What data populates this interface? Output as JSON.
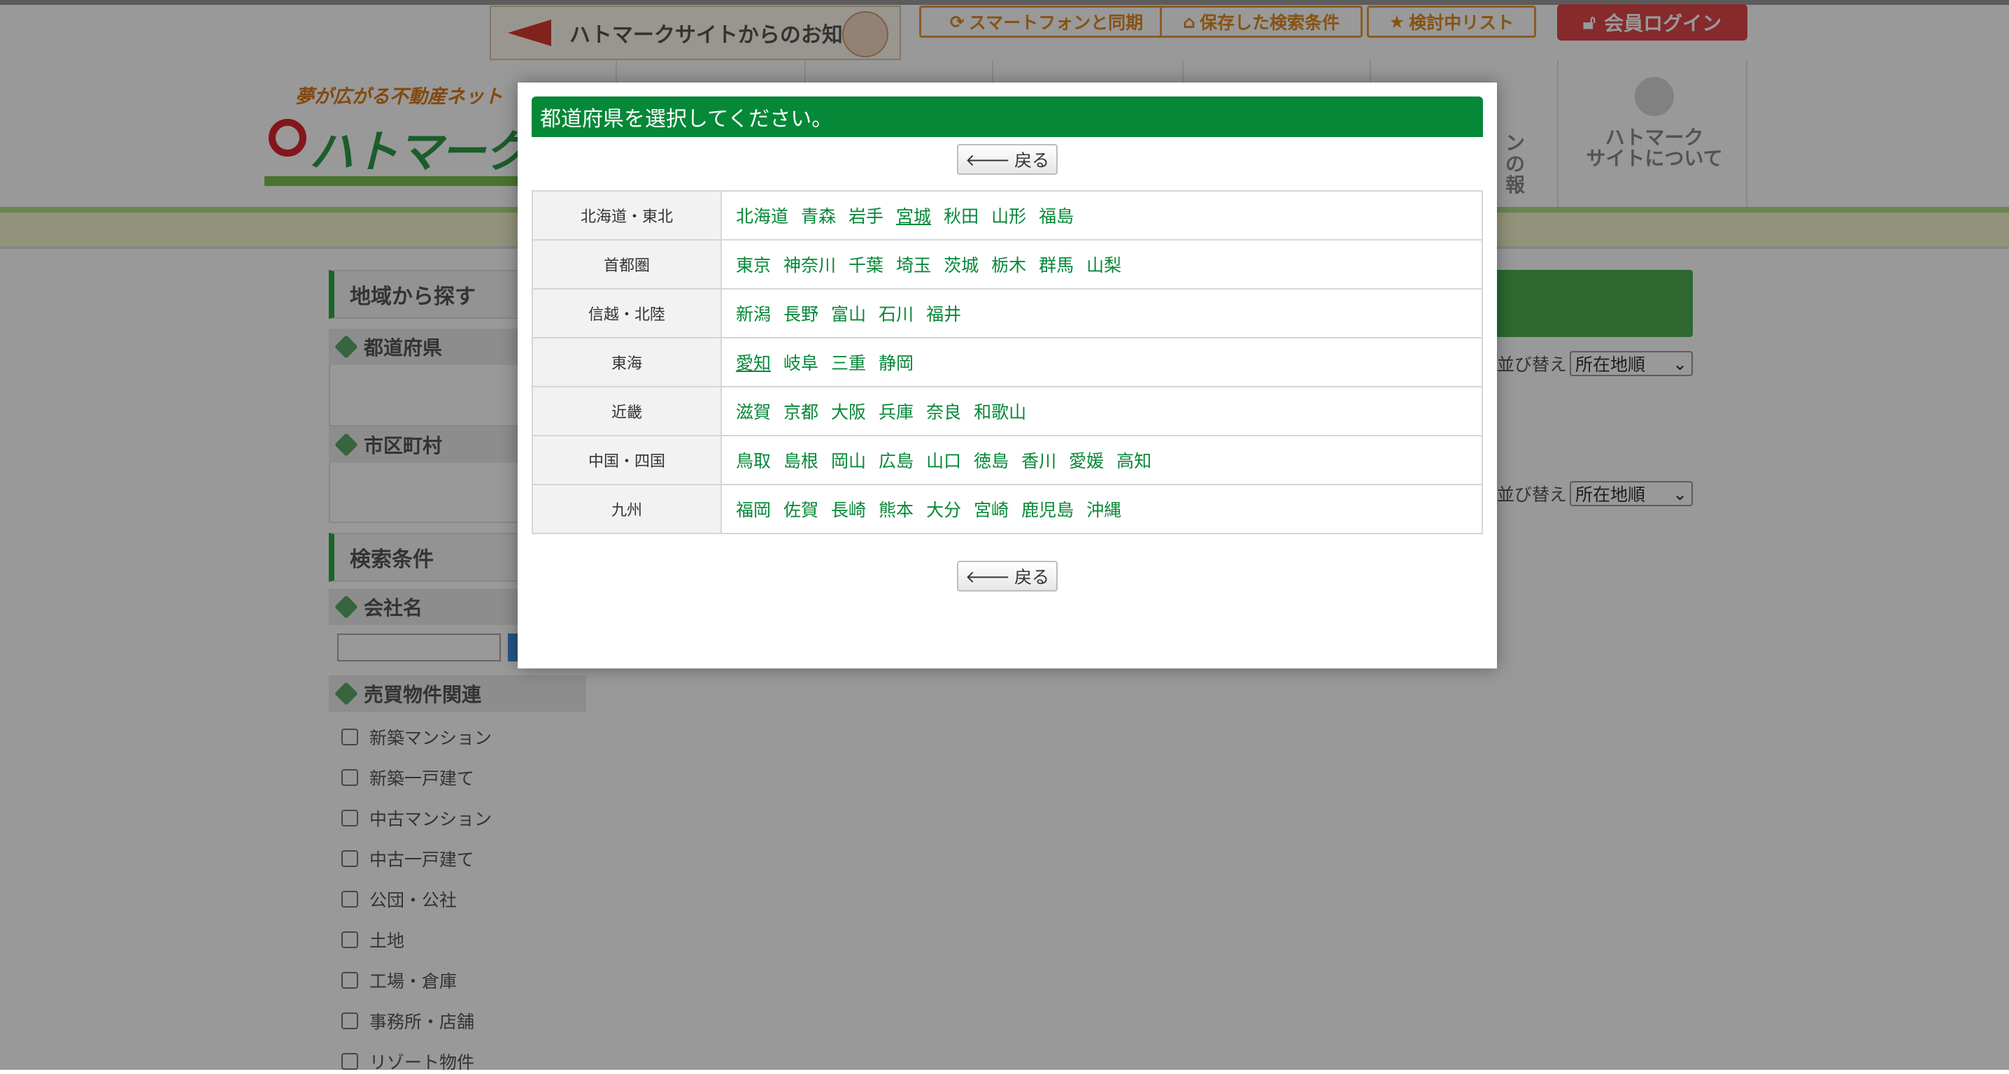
{
  "header": {
    "notice_label": "ハトマークサイトからのお知らせ",
    "buttons": [
      {
        "label": "スマートフォンと同期",
        "icon": "refresh-icon"
      },
      {
        "label": "保存した検索条件",
        "icon": "inbox-icon"
      },
      {
        "label": "検討中リスト",
        "icon": "star-icon"
      }
    ],
    "login_label": "会員ログイン",
    "tagline": "夢が広がる不動産ネット",
    "logo_text": "ハトマークサイ",
    "nav_about": [
      "ハトマーク",
      "サイトについて"
    ],
    "nav_partial": [
      "ンの",
      "報"
    ]
  },
  "sidebar": {
    "area_title": "地域から探す",
    "prefecture_label": "都道府県",
    "city_label": "市区町村",
    "conditions_title": "検索条件",
    "company_label": "会社名",
    "sales_label": "売買物件関連",
    "checkboxes": [
      "新築マンション",
      "新築一戸建て",
      "中古マンション",
      "中古一戸建て",
      "公団・公社",
      "土地",
      "工場・倉庫",
      "事務所・店舗",
      "リゾート物件"
    ]
  },
  "results": {
    "sort_label": "並び替え",
    "sort_value": "所在地順"
  },
  "modal": {
    "title": "都道府県を選択してください。",
    "back_label": "戻る",
    "regions": [
      {
        "name": "北海道・東北",
        "prefectures": [
          "北海道",
          "青森",
          "岩手",
          "宮城",
          "秋田",
          "山形",
          "福島"
        ]
      },
      {
        "name": "首都圏",
        "prefectures": [
          "東京",
          "神奈川",
          "千葉",
          "埼玉",
          "茨城",
          "栃木",
          "群馬",
          "山梨"
        ]
      },
      {
        "name": "信越・北陸",
        "prefectures": [
          "新潟",
          "長野",
          "富山",
          "石川",
          "福井"
        ]
      },
      {
        "name": "東海",
        "prefectures": [
          "愛知",
          "岐阜",
          "三重",
          "静岡"
        ]
      },
      {
        "name": "近畿",
        "prefectures": [
          "滋賀",
          "京都",
          "大阪",
          "兵庫",
          "奈良",
          "和歌山"
        ]
      },
      {
        "name": "中国・四国",
        "prefectures": [
          "鳥取",
          "島根",
          "岡山",
          "広島",
          "山口",
          "徳島",
          "香川",
          "愛媛",
          "高知"
        ]
      },
      {
        "name": "九州",
        "prefectures": [
          "福岡",
          "佐賀",
          "長崎",
          "熊本",
          "大分",
          "宮崎",
          "鹿児島",
          "沖縄"
        ]
      }
    ]
  },
  "colors": {
    "modal_header": "#058837",
    "link": "#058837",
    "login": "#e0464a",
    "accent_orange": "#e89a3c"
  }
}
